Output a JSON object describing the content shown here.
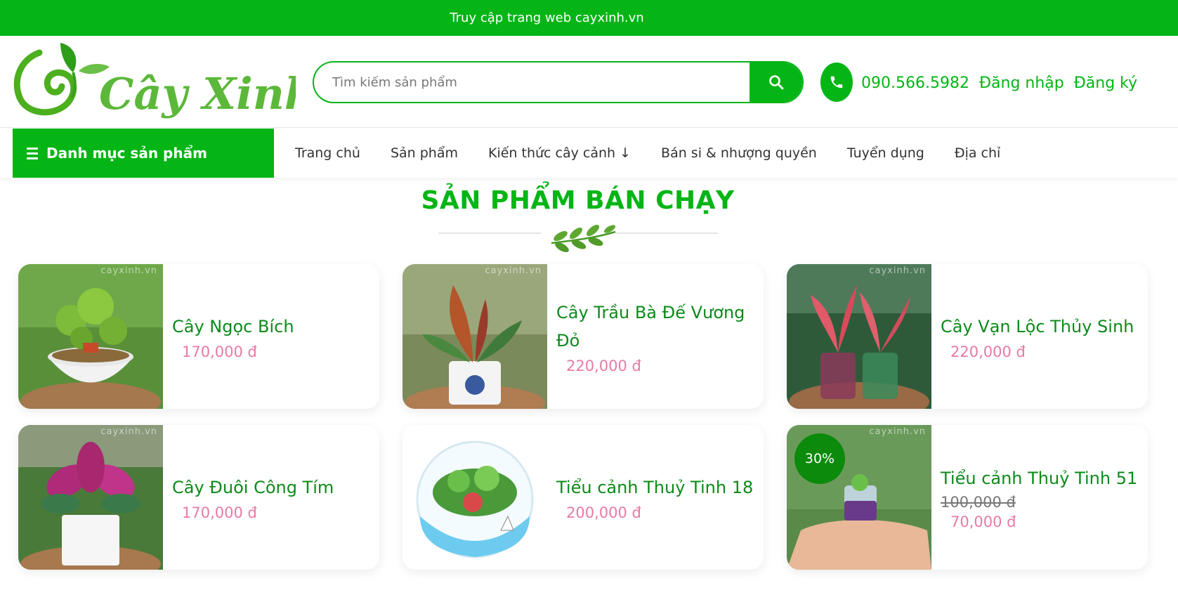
{
  "topbar": {
    "text": "Truy cập trang web cayxinh.vn"
  },
  "header": {
    "logo_text": "Cây Xinh",
    "search_placeholder": "Tìm kiếm sản phẩm",
    "phone": "090.566.5982",
    "login": "Đăng nhập",
    "register": "Đăng ký"
  },
  "nav": {
    "category_menu": "Danh mục sản phẩm",
    "items": [
      "Trang chủ",
      "Sản phẩm",
      "Kiến thức cây cảnh ↓",
      "Bán si & nhượng quyền",
      "Tuyển dụng",
      "Địa chỉ"
    ]
  },
  "section": {
    "title": "SẢN PHẨM BÁN CHẠY"
  },
  "watermark": "cayxinh.vn",
  "products": [
    {
      "name": "Cây Ngọc Bích",
      "price": "170,000 đ"
    },
    {
      "name": "Cây Trầu Bà Đế Vương Đỏ",
      "price": "220,000 đ"
    },
    {
      "name": "Cây Vạn Lộc Thủy Sinh",
      "price": "220,000 đ"
    },
    {
      "name": "Cây Đuôi Công Tím",
      "price": "170,000 đ"
    },
    {
      "name": "Tiểu cảnh Thuỷ Tinh 18",
      "price": "200,000 đ"
    },
    {
      "name": "Tiểu cảnh Thuỷ Tinh 51",
      "old_price": "100,000 đ",
      "price": "70,000 đ",
      "badge": "30%"
    }
  ],
  "colors": {
    "brand_green": "#04b515",
    "title_green": "#0e8a1a",
    "price_pink": "#e87aa5",
    "badge_green": "#0b8a0b"
  },
  "icons": {
    "search": "search-icon",
    "phone": "phone-icon",
    "menu": "hamburger-icon"
  }
}
